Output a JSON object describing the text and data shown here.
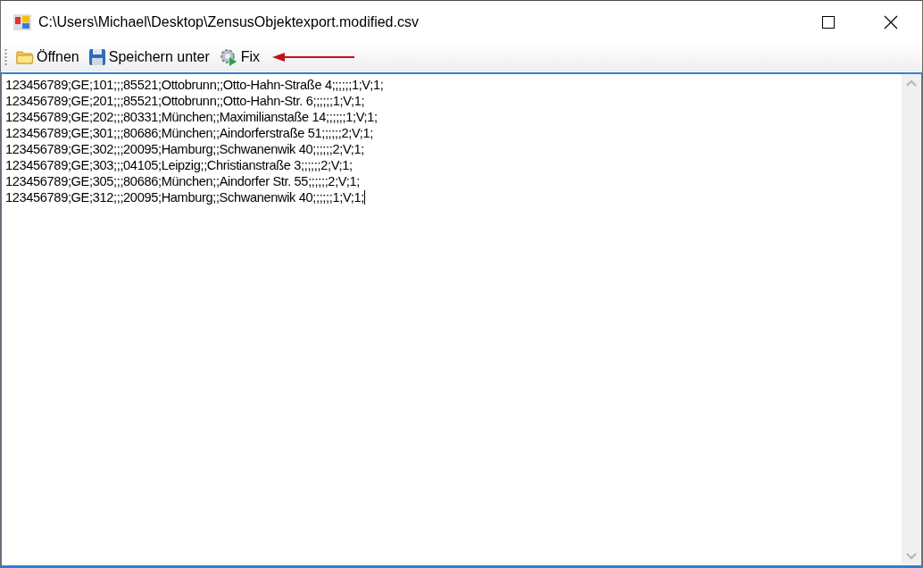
{
  "window": {
    "title": "C:\\Users\\Michael\\Desktop\\ZensusObjektexport.modified.csv"
  },
  "toolbar": [
    {
      "kind": "open",
      "label": "Öffnen"
    },
    {
      "kind": "save",
      "label": "Speichern unter"
    },
    {
      "kind": "run",
      "label": "Fix"
    }
  ],
  "editor": {
    "lines": [
      "123456789;GE;101;;;85521;Ottobrunn;;Otto-Hahn-Straße 4;;;;;;1;V;1;",
      "123456789;GE;201;;;85521;Ottobrunn;;Otto-Hahn-Str. 6;;;;;;1;V;1;",
      "123456789;GE;202;;;80331;München;;Maximilianstaße 14;;;;;;1;V;1;",
      "123456789;GE;301;;;80686;München;;Aindorferstraße 51;;;;;;2;V;1;",
      "123456789;GE;302;;;20095;Hamburg;;Schwanenwik 40;;;;;;2;V;1;",
      "123456789;GE;303;;;04105;Leipzig;;Christianstraße 3;;;;;;2;V;1;",
      "123456789;GE;305;;;80686;München;;Aindorfer Str. 55;;;;;;2;V;1;",
      "123456789;GE;312;;;20095;Hamburg;;Schwanenwik 40;;;;;;1;V;1;"
    ]
  }
}
